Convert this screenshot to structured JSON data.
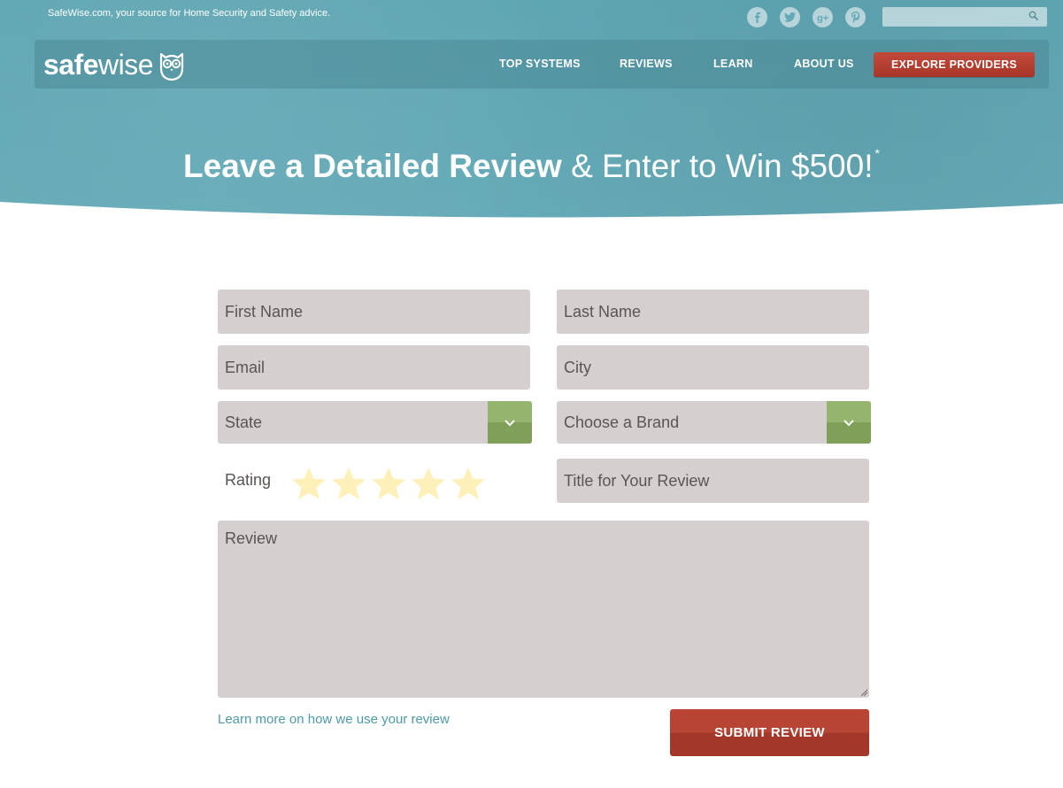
{
  "header": {
    "tagline": "SafeWise.com, your source for Home Security and Safety advice.",
    "social": [
      {
        "name": "facebook-icon",
        "glyph": "f"
      },
      {
        "name": "twitter-icon",
        "glyph": "t"
      },
      {
        "name": "google-plus-icon",
        "glyph": "g+"
      },
      {
        "name": "pinterest-icon",
        "glyph": "P"
      }
    ],
    "search": {
      "placeholder": ""
    },
    "logo": {
      "part1": "safe",
      "part2": "wise"
    },
    "nav": [
      "TOP SYSTEMS",
      "REVIEWS",
      "LEARN",
      "ABOUT US"
    ],
    "cta_label": "EXPLORE PROVIDERS"
  },
  "hero": {
    "headline_strong": "Leave a Detailed Review",
    "headline_light": "& Enter to Win $500!",
    "footnote_mark": "*"
  },
  "form": {
    "first_name": "First Name",
    "last_name": "Last Name",
    "email": "Email",
    "city": "City",
    "state": "State",
    "brand": "Choose a Brand",
    "rating_label": "Rating",
    "rating_value": 0,
    "rating_max": 5,
    "title": "Title for Your Review",
    "review": "Review",
    "learn_more": "Learn more on how we use your review",
    "submit": "SUBMIT REVIEW"
  },
  "colors": {
    "header_bg": "#62a8b5",
    "cta": "#b84434",
    "select_accent": "#95b46d",
    "field_bg": "#d5d0cf",
    "star": "#fdf0b8",
    "link": "#4f9aa8"
  }
}
